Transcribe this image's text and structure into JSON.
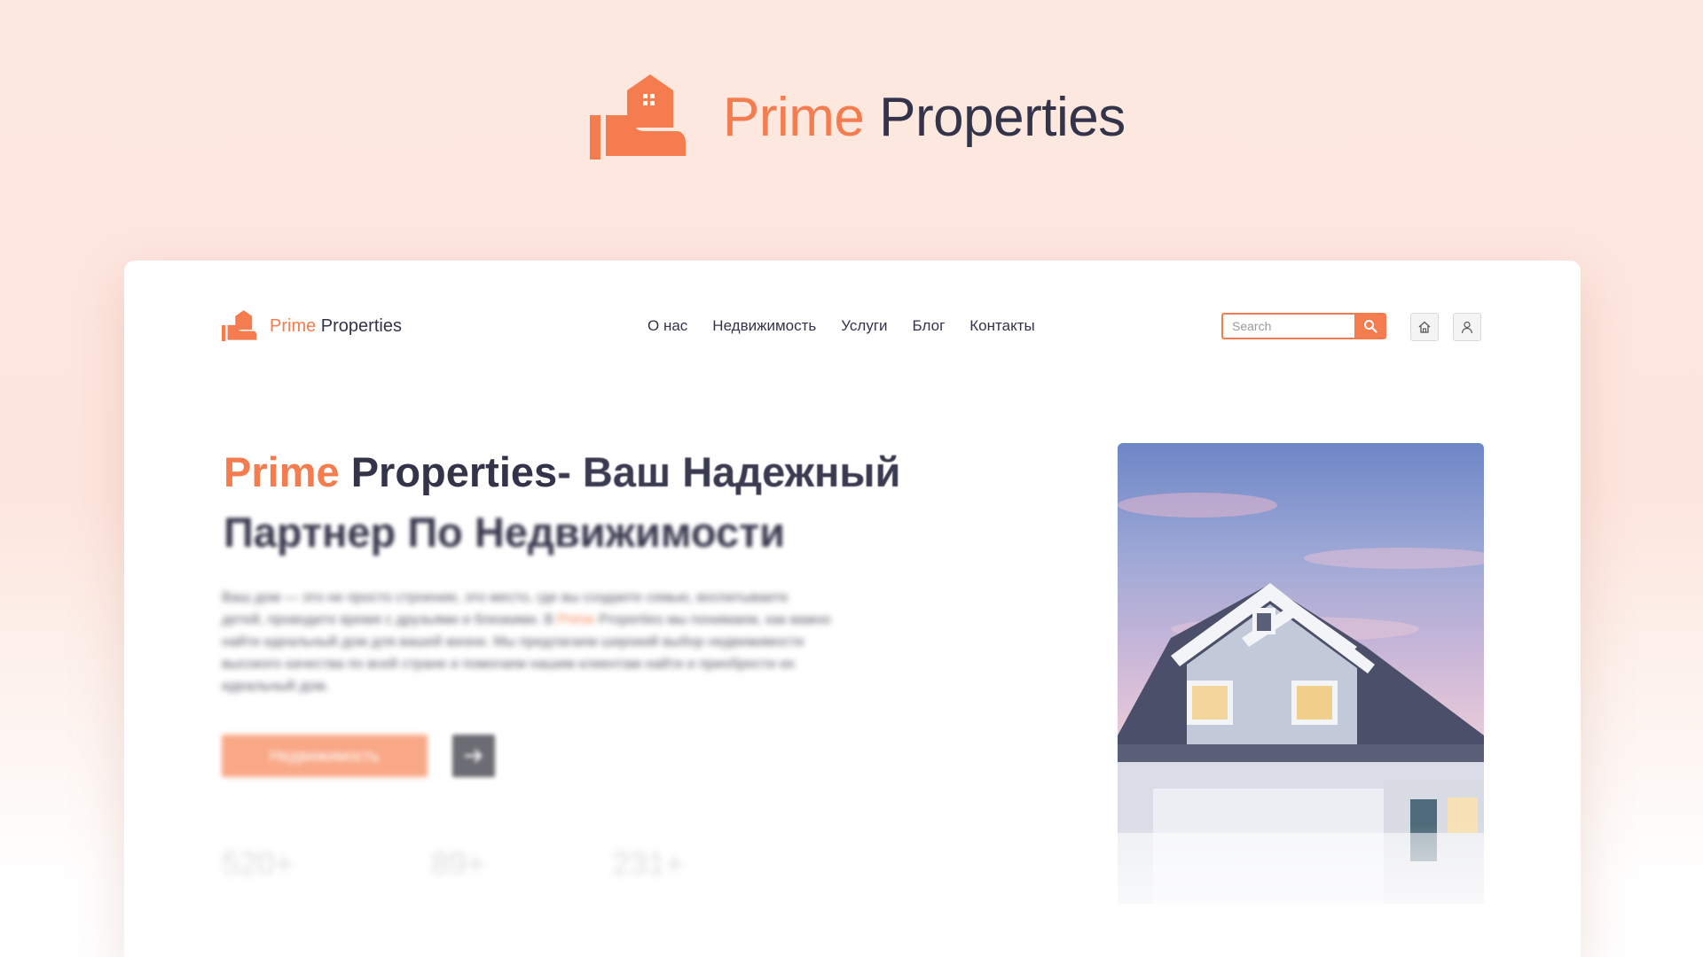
{
  "brand": {
    "part1": "Prime",
    "part2": "Properties"
  },
  "colors": {
    "accent": "#f47c4e",
    "dark": "#33334a",
    "background": "#fde8e0"
  },
  "nav": {
    "links": [
      "О нас",
      "Недвижимость",
      "Услуги",
      "Блог",
      "Контакты"
    ],
    "search_placeholder": "Search",
    "icons": [
      "search-icon",
      "home-icon",
      "user-icon"
    ]
  },
  "hero": {
    "title_accent": "Prime",
    "title_brand": " Properties",
    "title_rest": " - Ваш Надежный",
    "title_line2": "Партнер По Недвижимости",
    "paragraph_before": "Ваш дом — это не просто строение, это место, где вы создаете семью, воспитываете детей, проводите время с друзьями и близкими. В ",
    "paragraph_accent": "Prime",
    "paragraph_after": " Properties мы понимаем, как важно найти идеальный дом для вашей жизни. Мы предлагаем широкий выбор недвижимости высокого качества по всей стране и помогаем нашим клиентам найти и приобрести их идеальный дом.",
    "cta_label": "Недвижимость",
    "stats": [
      "520+",
      "89+",
      "231+"
    ]
  }
}
